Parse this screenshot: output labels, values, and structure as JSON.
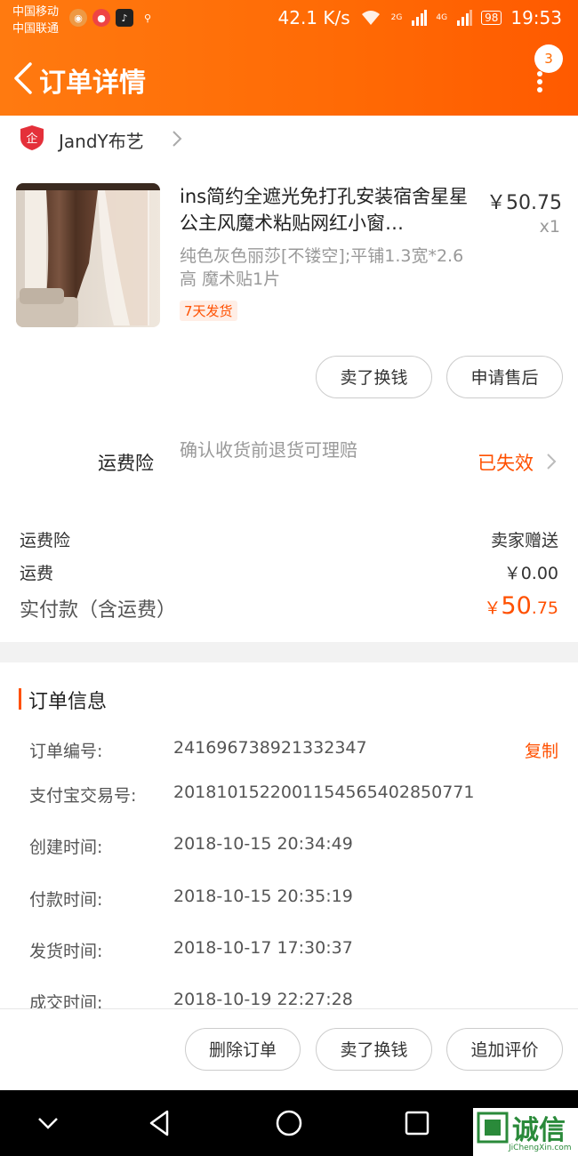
{
  "status_bar": {
    "carrier1": "中国移动",
    "carrier2": "中国联通",
    "speed": "42.1 K/s",
    "net1": "2G",
    "net2": "4G",
    "battery": "98",
    "time": "19:53"
  },
  "header": {
    "title": "订单详情",
    "badge": "3"
  },
  "shop": {
    "name": "JandY布艺"
  },
  "product": {
    "title": "ins简约全遮光免打孔安装宿舍星星公主风魔术粘贴网红小窗…",
    "price": "￥50.75",
    "qty": "x1",
    "sku": "纯色灰色丽莎[不镂空];平铺1.3宽*2.6高 魔术贴1片",
    "ship_tag": "7天发货"
  },
  "product_actions": {
    "resell": "卖了换钱",
    "after_sale": "申请售后"
  },
  "insurance": {
    "label": "运费险",
    "desc": "确认收货前退货可理赔",
    "status": "已失效"
  },
  "fees": [
    {
      "label": "运费险",
      "value": "卖家赠送"
    },
    {
      "label": "运费",
      "value": "￥0.00"
    }
  ],
  "total": {
    "label": "实付款（含运费）",
    "symbol": "￥",
    "int": "50",
    "dec": ".75"
  },
  "order_info": {
    "title": "订单信息",
    "copy": "复制",
    "rows": [
      {
        "k": "订单编号:",
        "v": "241696738921332347"
      },
      {
        "k": "支付宝交易号:",
        "v": "2018101522001154565402850771"
      },
      {
        "k": "创建时间:",
        "v": "2018-10-15 20:34:49"
      },
      {
        "k": "付款时间:",
        "v": "2018-10-15 20:35:19"
      },
      {
        "k": "发货时间:",
        "v": "2018-10-17 17:30:37"
      },
      {
        "k": "成交时间:",
        "v": "2018-10-19 22:27:28"
      }
    ]
  },
  "bottom_actions": {
    "delete": "删除订单",
    "resell": "卖了换钱",
    "review": "追加评价"
  },
  "watermark": {
    "text": "诚信",
    "sub": "JiChengXin.com"
  },
  "colors": {
    "accent": "#ff5000",
    "header": "#ff6a00"
  }
}
